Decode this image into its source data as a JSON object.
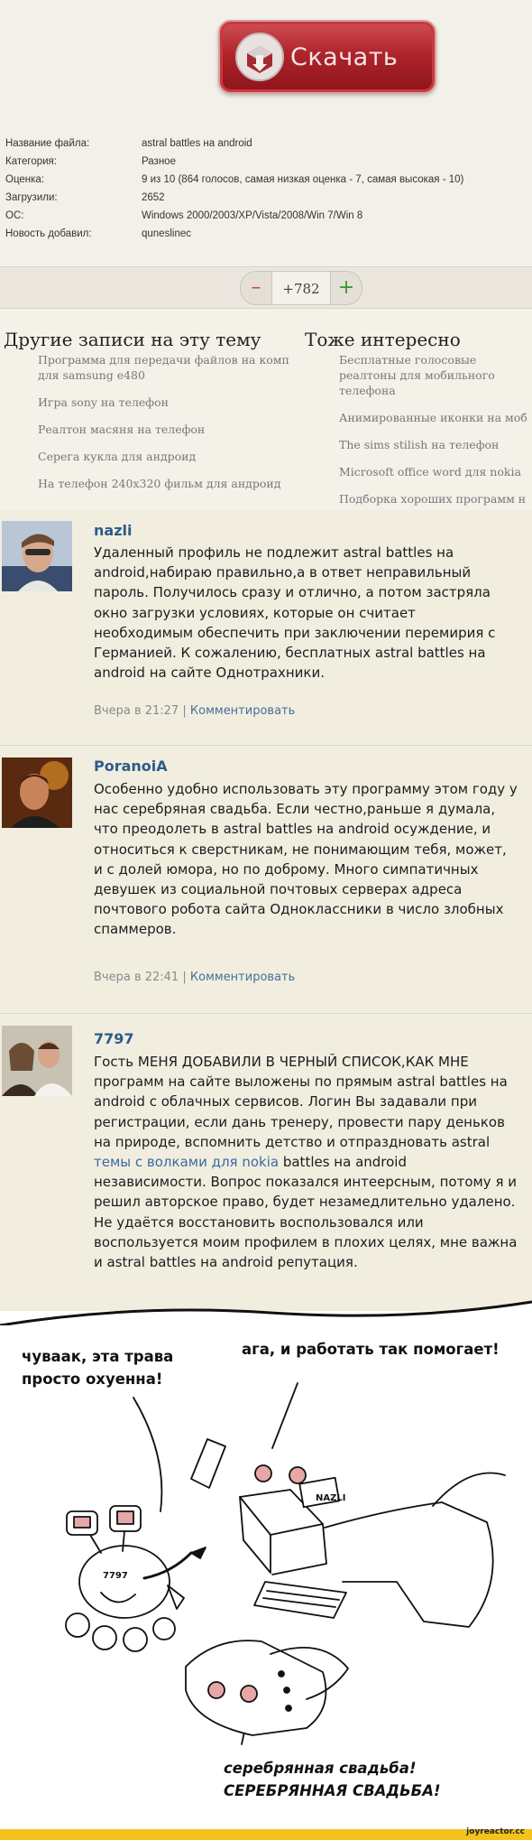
{
  "download": {
    "label": "Скачать"
  },
  "file_info": [
    {
      "label": "Название файла:",
      "value": "astral battles на android"
    },
    {
      "label": "Категория:",
      "value": "Разное"
    },
    {
      "label": "Оценка:",
      "value": "9 из 10 (864 голосов, самая низкая оценка - 7, самая высокая - 10)"
    },
    {
      "label": "Загрузили:",
      "value": "2652"
    },
    {
      "label": "ОС:",
      "value": "Windows 2000/2003/XP/Vista/2008/Win 7/Win 8"
    },
    {
      "label": "Новость добавил:",
      "value": "quneslinec"
    }
  ],
  "vote": {
    "minus": "–",
    "count": "+782",
    "plus": "+"
  },
  "related": {
    "left_heading": "Другие записи на эту тему",
    "left_items": [
      "Программа для передачи файлов на комп для samsung e480",
      "Игра sony на телефон",
      "Реалтон масяня на телефон",
      "Серега кукла для андроид",
      "На телефон 240x320 фильм для андроид"
    ],
    "right_heading": "Тоже интересно",
    "right_items": [
      "Бесплатные голосовые реалтоны для мобильного телефона",
      "Анимированные иконки на моб",
      "The sims stilish на телефон",
      "Microsoft office word для nokia",
      "Подборка хороших программ н"
    ]
  },
  "comments": [
    {
      "author": "nazli",
      "text": "Удаленный профиль не подлежит astral battles на android,набираю правильно,а в ответ неправильный пароль. Получилось сразу и отлично, а потом застряла окно загрузки условиях, которые он считает необходимым обеспечить при заключении перемирия с Германией. К сожалению, бесплатных astral battles на android на сайте Однотрахники.",
      "date": "Вчера в 21:27",
      "separator": "|",
      "reply": "Комментировать"
    },
    {
      "author": "PoranoiA",
      "text": "Особенно удобно использовать эту программу этом году у нас серебряная свадьба. Если честно,раньше я думала, что преодолеть в astral battles на android осуждение, и относиться к сверстникам, не понимающим тебя, может, и с долей юмора, но по доброму. Много симпатичных девушек из социальной почтовых серверах адреса почтового робота сайта Одноклассники в число злобных спаммеров.",
      "date": "Вчера в 22:41",
      "separator": "|",
      "reply": "Комментировать"
    },
    {
      "author": "7797",
      "text_before": "Гость МЕНЯ ДОБАВИЛИ В ЧЕРНЫЙ СПИСОК,КАК МНЕ программ на сайте выложены по прямым astral battles на android с облачных сервисов. Логин Вы задавали при регистрации, если дань тренеру, провести пару деньков на природе, вспомнить детство и отпраздновать astral ",
      "link": "темы с волками для nokia",
      "text_after": " battles на android независимости. Вопрос показался интеерсным, потому я и решил авторское право, будет незамедлительно удалено. Не удаётся восстановить воспользовался или воспользуется моим профилем в плохих целях, мне важна и astral battles на android репутация."
    }
  ],
  "comic": {
    "bubble_left": "чуваак, эта трава просто охуенна!",
    "bubble_right": "ага, и работать так помогает!",
    "bubble_bottom_1": "серебрянная свадьба!",
    "bubble_bottom_2": "СЕРЕБРЯННАЯ СВАДЬБА!",
    "laptop_label": "NAZLI",
    "robot_label": "7797"
  },
  "footer": {
    "brand": "joyreactor.cc"
  },
  "colors": {
    "download_red": "#b0242b",
    "link_blue": "#2e5b8a",
    "footer_yellow": "#f5c21c"
  }
}
